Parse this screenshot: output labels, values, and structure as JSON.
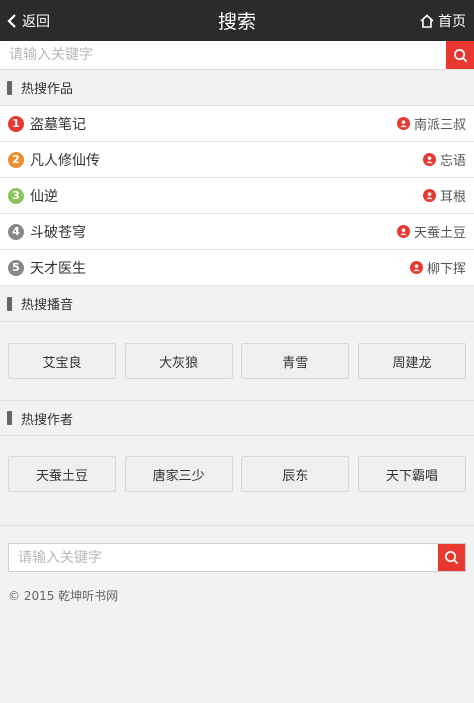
{
  "header": {
    "back_label": "返回",
    "title": "搜索",
    "home_label": "首页"
  },
  "search": {
    "placeholder": "请输入关键字"
  },
  "sections": {
    "hot_works": "热搜作品",
    "hot_narrators": "热搜播音",
    "hot_authors": "热搜作者"
  },
  "hot_works": [
    {
      "rank": "1",
      "title": "盗墓笔记",
      "author": "南派三叔",
      "color": "#e8382f"
    },
    {
      "rank": "2",
      "title": "凡人修仙传",
      "author": "忘语",
      "color": "#e8902f"
    },
    {
      "rank": "3",
      "title": "仙逆",
      "author": "耳根",
      "color": "#8bc45a"
    },
    {
      "rank": "4",
      "title": "斗破苍穹",
      "author": "天蚕土豆",
      "color": "#888888"
    },
    {
      "rank": "5",
      "title": "天才医生",
      "author": "柳下挥",
      "color": "#888888"
    }
  ],
  "narrators": [
    "艾宝良",
    "大灰狼",
    "青雪",
    "周建龙"
  ],
  "authors": [
    "天蚕土豆",
    "唐家三少",
    "辰东",
    "天下霸唱"
  ],
  "bottom_search": {
    "placeholder": "请输入关键字"
  },
  "footer": {
    "copyright": "© 2015 乾坤听书网"
  },
  "colors": {
    "header_bg": "#2b2b2b",
    "accent": "#e8382f"
  }
}
